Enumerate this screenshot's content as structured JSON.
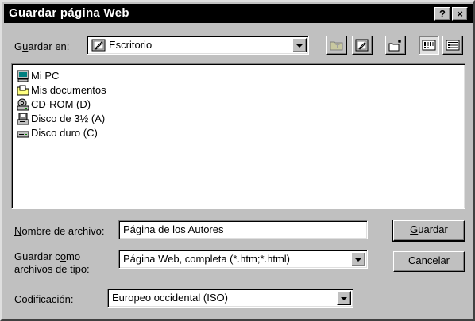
{
  "window": {
    "title": "Guardar página Web",
    "help_label": "?",
    "close_label": "×"
  },
  "location": {
    "label_pre": "G",
    "label_accel": "u",
    "label_post": "ardar en:",
    "value": "Escritorio"
  },
  "toolbar": {
    "buttons": [
      {
        "icon": "up-one-level-icon"
      },
      {
        "icon": "search-web-icon"
      },
      {
        "icon": "new-folder-icon"
      },
      {
        "icon": "list-view-icon"
      },
      {
        "icon": "details-view-icon"
      }
    ]
  },
  "files": [
    {
      "label": "Mi PC",
      "icon": "computer-icon"
    },
    {
      "label": "Mis documentos",
      "icon": "documents-folder-icon"
    },
    {
      "label": "CD-ROM (D)",
      "icon": "cdrom-drive-icon"
    },
    {
      "label": "Disco de 3½ (A)",
      "icon": "floppy-drive-icon"
    },
    {
      "label": "Disco duro (C)",
      "icon": "hard-drive-icon"
    }
  ],
  "filename": {
    "label_accel": "N",
    "label_post": "ombre de archivo:",
    "value": "Página de los Autores"
  },
  "filetype": {
    "label_line1_pre": "Guardar c",
    "label_line1_accel": "o",
    "label_line1_post": "mo",
    "label_line2": "archivos de tipo:",
    "value": "Página Web, completa (*.htm;*.html)"
  },
  "encoding": {
    "label_accel": "C",
    "label_post": "odificación:",
    "value": "Europeo occidental (ISO)"
  },
  "buttons": {
    "save_accel": "G",
    "save_post": "uardar",
    "cancel": "Cancelar"
  },
  "colors": {
    "face": "#c0c0c0",
    "titlebar": "#000000",
    "field": "#ffffff"
  }
}
